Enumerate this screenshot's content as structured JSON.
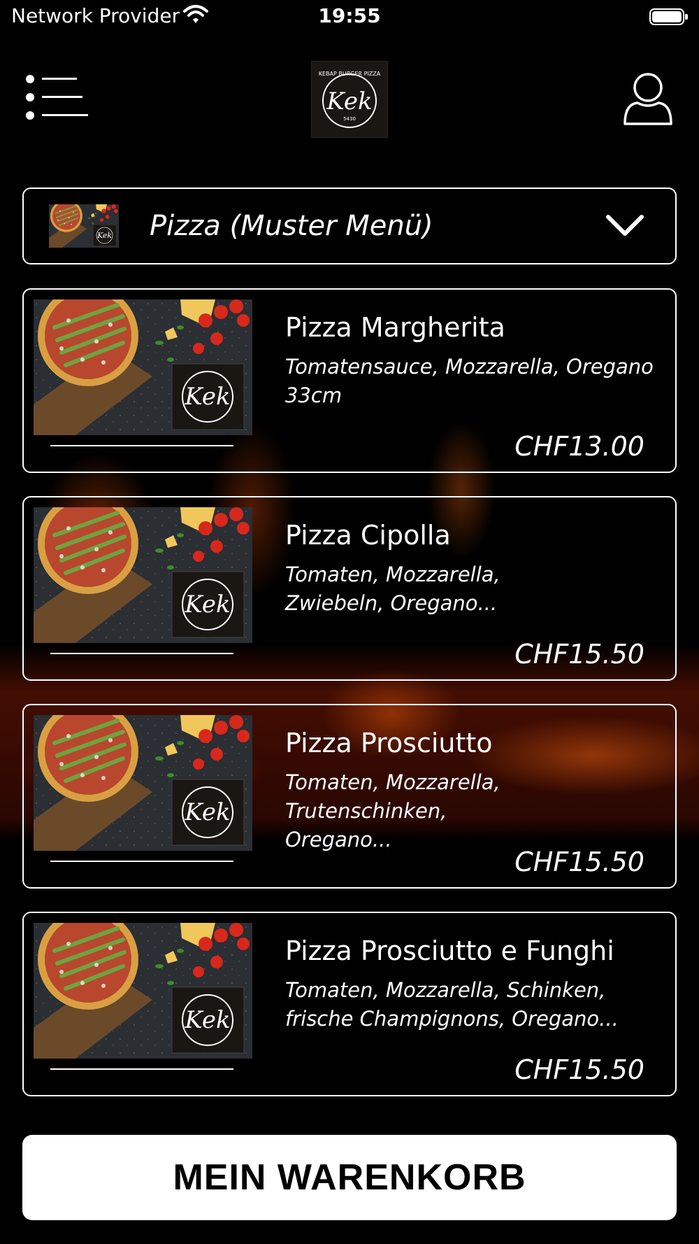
{
  "status_bar": {
    "provider": "Network Provider",
    "time": "19:55"
  },
  "header": {
    "logo_text_top": "KEBAP BURGER PIZZA",
    "logo_text_main": "Kek",
    "logo_text_bottom": "5430"
  },
  "category": {
    "label": "Pizza (Muster Menü)"
  },
  "products": [
    {
      "title": "Pizza Margherita",
      "description": "Tomatensauce, Mozzarella, Oregano 33cm",
      "price": "CHF13.00"
    },
    {
      "title": "Pizza Cipolla",
      "description": "Tomaten, Mozzarella, Zwiebeln, Oregano...",
      "price": "CHF15.50"
    },
    {
      "title": "Pizza Prosciutto",
      "description": "Tomaten, Mozzarella, Trutenschinken, Oregano...",
      "price": "CHF15.50"
    },
    {
      "title": "Pizza Prosciutto e Funghi",
      "description": "Tomaten, Mozzarella, Schinken, frische Champignons, Oregano...",
      "price": "CHF15.50"
    }
  ],
  "cart_button": {
    "label": "MEIN WARENKORB"
  },
  "colors": {
    "background": "#000000",
    "foreground": "#ffffff",
    "fire": "#c8460a"
  }
}
